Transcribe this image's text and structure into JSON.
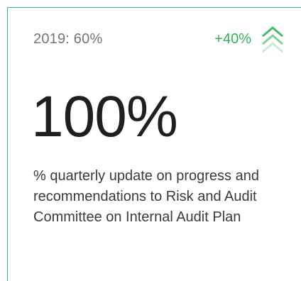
{
  "card": {
    "baseline_text": "2019: 60%",
    "change_text": "+40%",
    "change_icon": "double-chevron-up-icon",
    "value_text": "100%",
    "description": "% quarterly update on progress and recommendations to Risk and Audit Committee on Internal Audit Plan"
  },
  "colors": {
    "accent": "#3dbb6a",
    "accent_light": "#a9dfbf",
    "text_muted": "#757575",
    "text_main": "#1f1f1f"
  }
}
